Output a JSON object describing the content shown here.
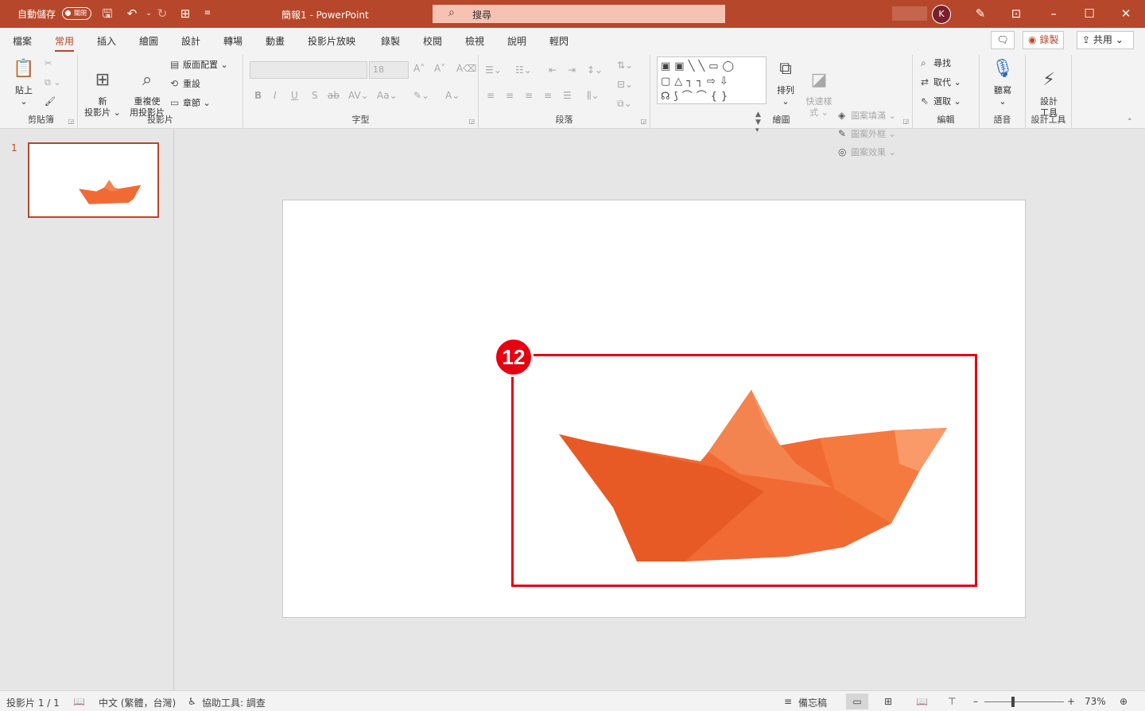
{
  "titlebar": {
    "autosave_label": "自動儲存",
    "autosave_state": "關閉",
    "doc_title": "簡報1  -  PowerPoint",
    "search_placeholder": "搜尋",
    "avatar_initial": "K",
    "accent": "#b7472a"
  },
  "tabs": [
    "檔案",
    "常用",
    "插入",
    "繪圖",
    "設計",
    "轉場",
    "動畫",
    "投影片放映",
    "錄製",
    "校閱",
    "檢視",
    "說明",
    "輕閃"
  ],
  "active_tab": "常用",
  "tab_actions": {
    "record": "錄製",
    "share": "共用"
  },
  "ribbon": {
    "clipboard": {
      "label": "剪貼簿",
      "paste": "貼上"
    },
    "slides": {
      "label": "投影片",
      "new_slide": "新\n投影片",
      "reuse_slide": "重複使\n用投影片",
      "layout": "版面配置",
      "reset": "重設",
      "section": "章節"
    },
    "font": {
      "label": "字型",
      "font_size": "18"
    },
    "paragraph": {
      "label": "段落"
    },
    "drawing": {
      "label": "繪圖",
      "arrange": "排列",
      "quick_styles": "快速樣\n式",
      "shape_fill": "圖案填滿",
      "shape_outline": "圖案外框",
      "shape_effects": "圖案效果"
    },
    "editing": {
      "label": "編輯",
      "find": "尋找",
      "replace": "取代",
      "select": "選取"
    },
    "voice": {
      "label": "語音",
      "dictate": "聽寫"
    },
    "designer": {
      "label": "設計工具",
      "design_ideas": "設計\n工具"
    }
  },
  "slides_pane": {
    "slide_number": "1"
  },
  "slide": {
    "callout_number": "12",
    "callout_color": "#e60012",
    "boat_color": "#f26a33"
  },
  "statusbar": {
    "slide_info": "投影片 1 / 1",
    "language": "中文 (繁體，台灣)",
    "accessibility": "協助工具: 調查",
    "notes": "備忘稿",
    "zoom": "73%"
  }
}
